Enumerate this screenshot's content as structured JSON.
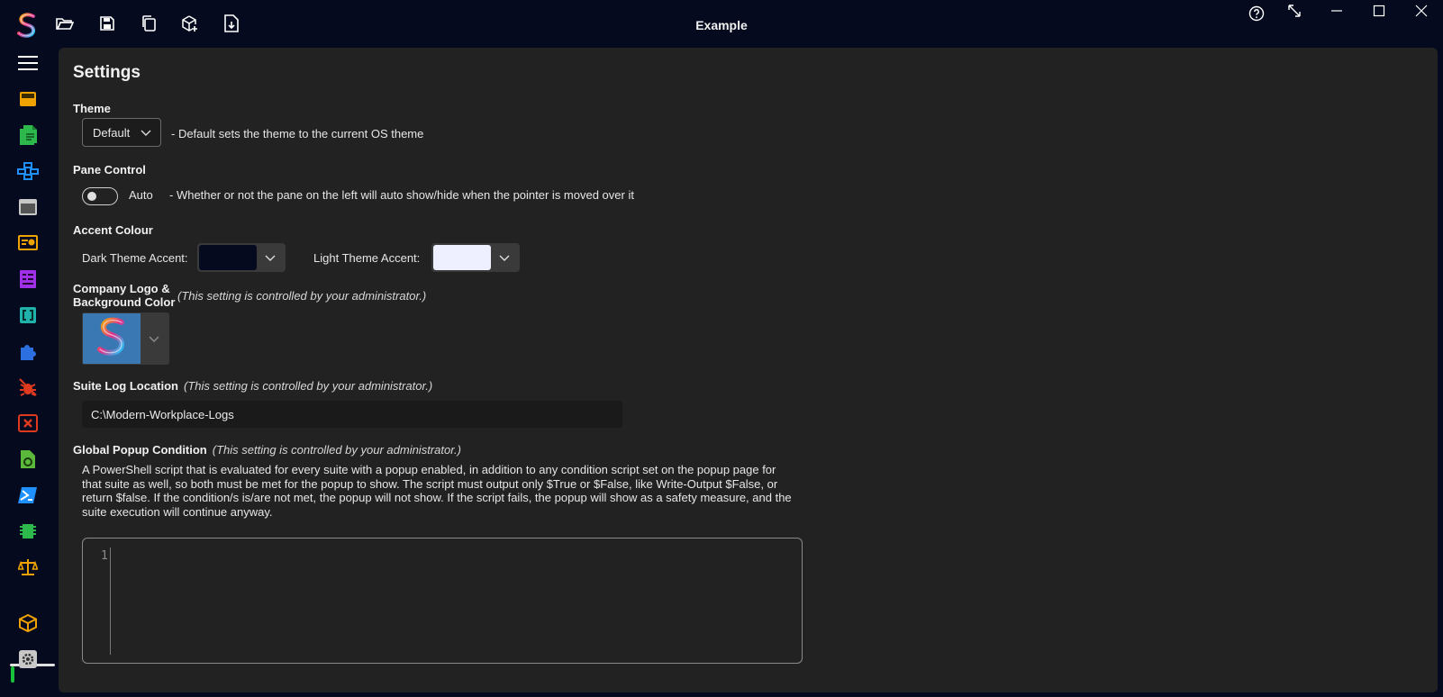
{
  "window": {
    "title": "Example"
  },
  "toolbar": {
    "buttons": [
      {
        "icon": "folder-open-icon"
      },
      {
        "icon": "save-icon"
      },
      {
        "icon": "copy-icon"
      },
      {
        "icon": "new-package-icon"
      },
      {
        "icon": "export-file-icon"
      }
    ]
  },
  "window_controls": [
    "help-icon",
    "resize-icon",
    "minimize-icon",
    "maximize-icon",
    "close-icon"
  ],
  "sidebar": {
    "items": [
      {
        "icon": "hamburger-menu-icon",
        "color": "#ffffff"
      },
      {
        "icon": "inbox-icon",
        "color": "#f0a200"
      },
      {
        "icon": "documents-icon",
        "color": "#2db84b"
      },
      {
        "icon": "network-icon",
        "color": "#1e90ff"
      },
      {
        "icon": "window-icon",
        "color": "#c8c8c8"
      },
      {
        "icon": "certificate-icon",
        "color": "#f0a200"
      },
      {
        "icon": "form-icon",
        "color": "#a030e8"
      },
      {
        "icon": "brackets-icon",
        "color": "#20b2aa"
      },
      {
        "icon": "puzzle-icon",
        "color": "#2b6fe0"
      },
      {
        "icon": "bug-off-icon",
        "color": "#e03a1e"
      },
      {
        "icon": "error-window-icon",
        "color": "#e03a1e"
      },
      {
        "icon": "script-file-icon",
        "color": "#5bb83a"
      },
      {
        "icon": "powershell-icon",
        "color": "#1e90ff"
      },
      {
        "icon": "chip-icon",
        "color": "#2db84b"
      },
      {
        "icon": "scales-icon",
        "color": "#f0a200"
      },
      {
        "icon": "package-icon",
        "color": "#f0a200"
      },
      {
        "icon": "settings-icon",
        "color": "#c8c8c8"
      }
    ]
  },
  "settings": {
    "title": "Settings",
    "theme": {
      "label": "Theme",
      "value": "Default",
      "description": "- Default sets the theme to the current OS theme"
    },
    "pane_control": {
      "label": "Pane Control",
      "toggle_label": "Auto",
      "toggle_on": false,
      "description": "- Whether or not the pane on the left will auto show/hide when the pointer is moved over it"
    },
    "accent": {
      "label": "Accent Colour",
      "dark_label": "Dark Theme Accent:",
      "dark_color": "#050a1f",
      "light_label": "Light Theme Accent:",
      "light_color": "#eef0ff"
    },
    "company_logo": {
      "label_line1": "Company Logo &",
      "label_line2": "Background Color",
      "note": "(This setting is controlled by your administrator.)",
      "background_color": "#3a78b3"
    },
    "log_location": {
      "label": "Suite Log Location",
      "note": "(This setting is controlled by your administrator.)",
      "value": "C:\\Modern-Workplace-Logs"
    },
    "popup_condition": {
      "label": "Global Popup Condition",
      "note": "(This setting is controlled by your administrator.)",
      "description": "A PowerShell script that is evaluated for every suite with a popup enabled, in addition to any condition script set on the popup page for that suite as well, so both must be met for the popup to show. The script must output only $True or $False, like Write-Output $False, or return $false. If the condition/s is/are not met, the popup will not show. If the script fails, the popup will show as a safety measure, and the suite execution will continue anyway.",
      "line_number": "1"
    }
  }
}
